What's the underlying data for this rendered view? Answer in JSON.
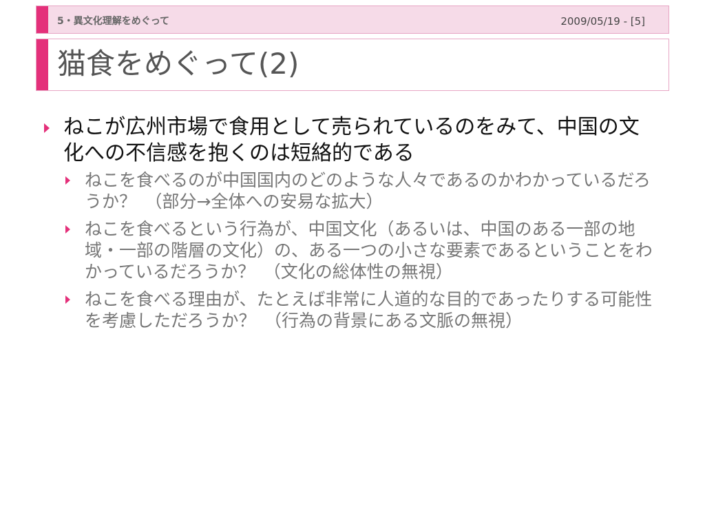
{
  "header": {
    "section": "5・異文化理解をめぐって",
    "date_page": "2009/05/19 - [5]"
  },
  "title": "猫食をめぐって(2)",
  "bullets": [
    {
      "text": "ねこが広州市場で食用として売られているのをみて、中国の文化への不信感を抱くのは短絡的である",
      "children": [
        {
          "text": "ねこを食べるのが中国国内のどのような人々であるのかわかっているだろうか？　（部分→全体への安易な拡大）"
        },
        {
          "text": "ねこを食べるという行為が、中国文化（あるいは、中国のある一部の地域・一部の階層の文化）の、ある一つの小さな要素であるということをわかっているだろうか？　（文化の総体性の無視）"
        },
        {
          "text": "ねこを食べる理由が、たとえば非常に人道的な目的であったりする可能性を考慮しただろうか？　（行為の背景にある文脈の無視）"
        }
      ]
    }
  ],
  "colors": {
    "accent": "#e4307a",
    "header_bg": "#f6dbe8",
    "border": "#e7a6c4"
  }
}
